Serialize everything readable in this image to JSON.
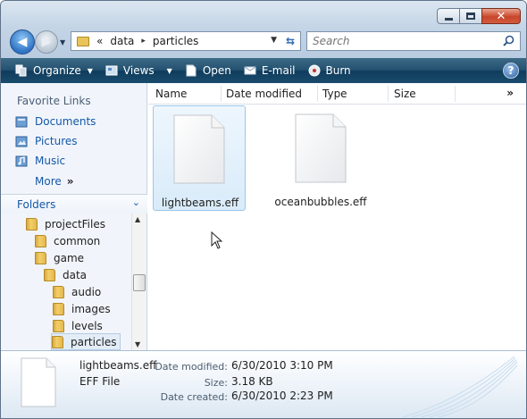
{
  "titlebar": {
    "minimize_glyph": "—",
    "maximize_glyph": "□",
    "close_glyph": "✕"
  },
  "navigation": {
    "back_glyph": "◀",
    "forward_glyph": "▶",
    "recent_glyph": "▼"
  },
  "address": {
    "overflow": "«",
    "crumbs": [
      "data",
      "particles"
    ],
    "separator": "▸",
    "dropdown_glyph": "▼",
    "refresh_glyph": "⇆"
  },
  "search": {
    "placeholder": "Search"
  },
  "toolbar": {
    "organize": "Organize",
    "views": "Views",
    "open": "Open",
    "email": "E-mail",
    "burn": "Burn",
    "arrow": "▼",
    "help": "?"
  },
  "favorites": {
    "title": "Favorite Links",
    "items": [
      {
        "label": "Documents",
        "icon": "documents-icon"
      },
      {
        "label": "Pictures",
        "icon": "pictures-icon"
      },
      {
        "label": "Music",
        "icon": "music-icon"
      }
    ],
    "more": "More",
    "more_glyph": "»"
  },
  "folders": {
    "title": "Folders",
    "chevron": "⌄",
    "tree": [
      {
        "label": "projectFiles",
        "level": 1
      },
      {
        "label": "common",
        "level": 2
      },
      {
        "label": "game",
        "level": 2
      },
      {
        "label": "data",
        "level": 3
      },
      {
        "label": "audio",
        "level": 4
      },
      {
        "label": "images",
        "level": 4
      },
      {
        "label": "levels",
        "level": 4
      },
      {
        "label": "particles",
        "level": 4,
        "selected": true
      }
    ],
    "scroll_up": "▲",
    "scroll_down": "▼"
  },
  "columns": {
    "name": "Name",
    "date_modified": "Date modified",
    "type": "Type",
    "size": "Size",
    "more": "»"
  },
  "files": [
    {
      "name": "lightbeams.eff",
      "selected": true
    },
    {
      "name": "oceanbubbles.eff",
      "selected": false
    }
  ],
  "details": {
    "name": "lightbeams.eff",
    "type": "EFF File",
    "date_modified_label": "Date modified:",
    "date_modified": "6/30/2010 3:10 PM",
    "size_label": "Size:",
    "size": "3.18 KB",
    "date_created_label": "Date created:",
    "date_created": "6/30/2010 2:23 PM"
  },
  "colors": {
    "toolbar_top": "#3d6a86",
    "toolbar_bottom": "#0f3c5c",
    "link_blue": "#1457a8",
    "selection_blue": "#d9ebfa"
  }
}
